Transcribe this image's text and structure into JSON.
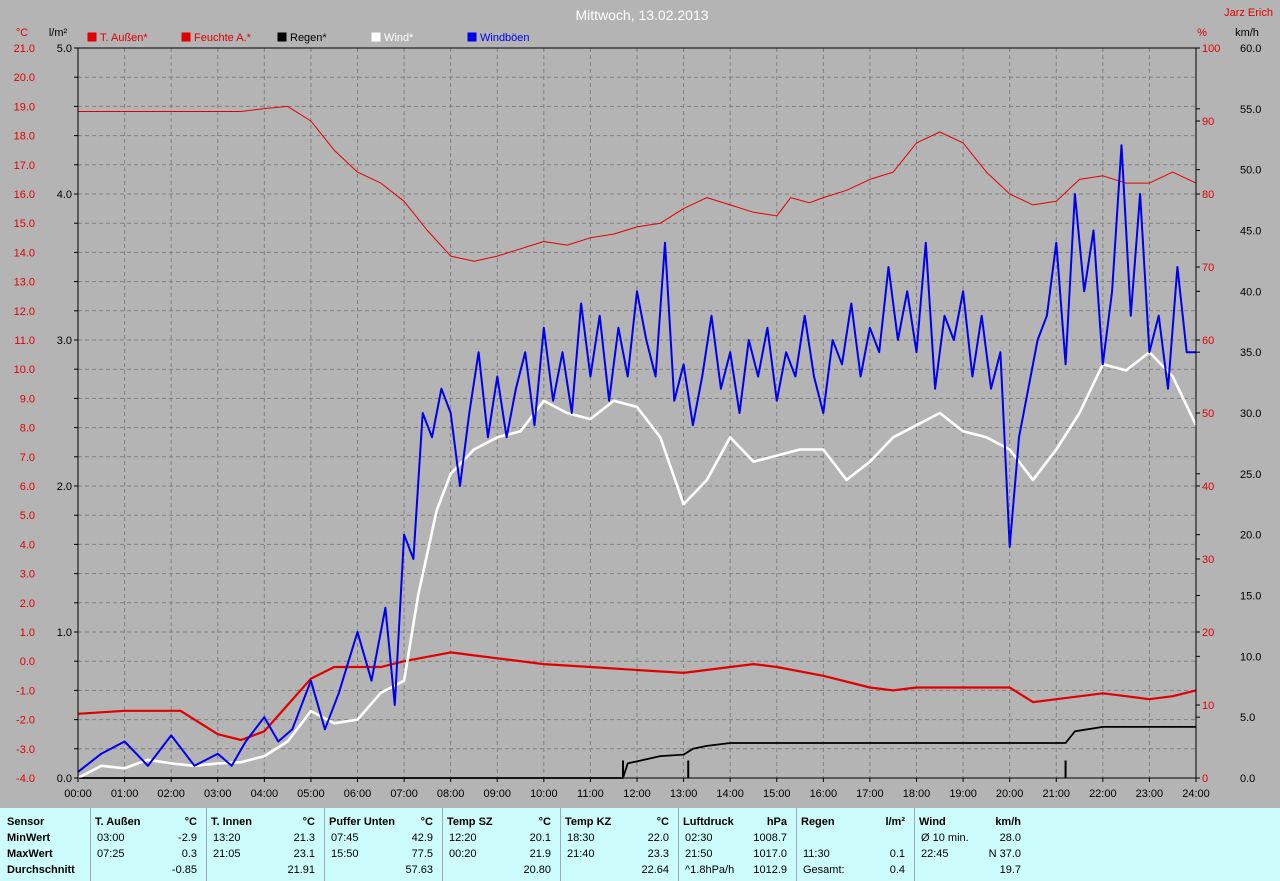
{
  "colors": {
    "background": "#b4b4b4",
    "temp_out": "#e00000",
    "humidity": "#e00000",
    "rain": "#000000",
    "wind": "#ffffff",
    "gusts": "#0000ee",
    "stats_background": "#ccfcfc"
  },
  "chart_data": {
    "type": "line",
    "title": "Mittwoch, 13.02.2013",
    "watermark": "Jarz Erich",
    "legend_position": "top-left",
    "grid": true,
    "x_range": [
      0,
      24
    ],
    "x_ticks": [
      "00:00",
      "01:00",
      "02:00",
      "03:00",
      "04:00",
      "05:00",
      "06:00",
      "07:00",
      "08:00",
      "09:00",
      "10:00",
      "11:00",
      "12:00",
      "13:00",
      "14:00",
      "15:00",
      "16:00",
      "17:00",
      "18:00",
      "19:00",
      "20:00",
      "21:00",
      "22:00",
      "23:00",
      "24:00"
    ],
    "axes": {
      "temp": {
        "unit": "°C",
        "range": [
          -4,
          21
        ],
        "ticks": [
          "21.0",
          "20.0",
          "19.0",
          "18.0",
          "17.0",
          "16.0",
          "15.0",
          "14.0",
          "13.0",
          "12.0",
          "11.0",
          "10.0",
          "9.0",
          "8.0",
          "7.0",
          "6.0",
          "5.0",
          "4.0",
          "3.0",
          "2.0",
          "1.0",
          "0.0",
          "-1.0",
          "-2.0",
          "-3.0",
          "-4.0"
        ]
      },
      "rain": {
        "unit": "l/m²",
        "range": [
          0,
          5
        ],
        "ticks": [
          "5.0",
          "4.0",
          "3.0",
          "2.0",
          "1.0",
          "0.0"
        ]
      },
      "humidity": {
        "unit": "%",
        "range": [
          0,
          100
        ],
        "ticks": [
          "100",
          "90",
          "80",
          "70",
          "60",
          "50",
          "40",
          "30",
          "20",
          "10",
          "0"
        ]
      },
      "wind": {
        "unit": "km/h",
        "range": [
          0,
          60
        ],
        "ticks": [
          "60.0",
          "55.0",
          "50.0",
          "45.0",
          "40.0",
          "35.0",
          "30.0",
          "25.0",
          "20.0",
          "15.0",
          "10.0",
          "5.0",
          "0.0"
        ]
      }
    },
    "series": [
      {
        "name": "T. Außen*",
        "axis": "temp",
        "color": "#e00000",
        "width": 2.2,
        "points": [
          [
            0,
            -1.8
          ],
          [
            1,
            -1.7
          ],
          [
            2.2,
            -1.7
          ],
          [
            3,
            -2.5
          ],
          [
            3.5,
            -2.7
          ],
          [
            4,
            -2.4
          ],
          [
            4.5,
            -1.5
          ],
          [
            5,
            -0.6
          ],
          [
            5.5,
            -0.2
          ],
          [
            6,
            -0.2
          ],
          [
            6.5,
            -0.2
          ],
          [
            7,
            0.0
          ],
          [
            8,
            0.3
          ],
          [
            8.5,
            0.2
          ],
          [
            9,
            0.1
          ],
          [
            10,
            -0.1
          ],
          [
            11,
            -0.2
          ],
          [
            12,
            -0.3
          ],
          [
            13,
            -0.4
          ],
          [
            14,
            -0.2
          ],
          [
            14.5,
            -0.1
          ],
          [
            15,
            -0.2
          ],
          [
            16,
            -0.5
          ],
          [
            17,
            -0.9
          ],
          [
            17.5,
            -1.0
          ],
          [
            18,
            -0.9
          ],
          [
            19,
            -0.9
          ],
          [
            20,
            -0.9
          ],
          [
            20.5,
            -1.4
          ],
          [
            21,
            -1.3
          ],
          [
            22,
            -1.1
          ],
          [
            22.5,
            -1.2
          ],
          [
            23,
            -1.3
          ],
          [
            23.5,
            -1.2
          ],
          [
            24,
            -1.0
          ]
        ]
      },
      {
        "name": "Feuchte A.*",
        "axis": "humidity",
        "color": "#e00000",
        "width": 1,
        "points": [
          [
            0,
            91.3
          ],
          [
            3.5,
            91.3
          ],
          [
            4,
            91.7
          ],
          [
            4.5,
            92
          ],
          [
            5,
            90
          ],
          [
            5.5,
            86
          ],
          [
            6,
            83
          ],
          [
            6.5,
            81.5
          ],
          [
            7,
            79
          ],
          [
            7.5,
            75
          ],
          [
            8,
            71.5
          ],
          [
            8.5,
            70.8
          ],
          [
            9,
            71.5
          ],
          [
            10,
            73.5
          ],
          [
            10.5,
            73
          ],
          [
            11,
            74
          ],
          [
            11.5,
            74.5
          ],
          [
            12,
            75.5
          ],
          [
            12.5,
            76
          ],
          [
            13,
            78
          ],
          [
            13.5,
            79.5
          ],
          [
            14,
            78.5
          ],
          [
            14.5,
            77.5
          ],
          [
            15,
            77
          ],
          [
            15.3,
            79.5
          ],
          [
            15.7,
            78.8
          ],
          [
            16,
            79.5
          ],
          [
            16.5,
            80.5
          ],
          [
            17,
            82
          ],
          [
            17.5,
            83
          ],
          [
            18,
            87
          ],
          [
            18.5,
            88.5
          ],
          [
            19,
            87
          ],
          [
            19.5,
            83
          ],
          [
            20,
            80
          ],
          [
            20.5,
            78.5
          ],
          [
            21,
            79
          ],
          [
            21.5,
            82
          ],
          [
            22,
            82.5
          ],
          [
            22.5,
            81.5
          ],
          [
            23,
            81.5
          ],
          [
            23.5,
            83
          ],
          [
            24,
            81.5
          ]
        ]
      },
      {
        "name": "Regen*",
        "axis": "rain",
        "color": "#000000",
        "width": 1.8,
        "points": [
          [
            0,
            0
          ],
          [
            11.7,
            0
          ],
          [
            11.8,
            0.1
          ],
          [
            12.5,
            0.15
          ],
          [
            13,
            0.16
          ],
          [
            13.2,
            0.2
          ],
          [
            13.5,
            0.22
          ],
          [
            14,
            0.24
          ],
          [
            20,
            0.24
          ],
          [
            21.2,
            0.24
          ],
          [
            21.4,
            0.32
          ],
          [
            22,
            0.35
          ],
          [
            24,
            0.35
          ]
        ],
        "spikes": [
          [
            11.7,
            0.12
          ],
          [
            13.1,
            0.12
          ],
          [
            21.2,
            0.12
          ]
        ]
      },
      {
        "name": "Wind*",
        "axis": "wind",
        "color": "#ffffff",
        "width": 2.6,
        "points": [
          [
            0,
            0
          ],
          [
            0.5,
            1
          ],
          [
            1,
            0.8
          ],
          [
            1.5,
            1.5
          ],
          [
            2,
            1.2
          ],
          [
            2.5,
            1
          ],
          [
            3,
            1.2
          ],
          [
            3.5,
            1.3
          ],
          [
            4,
            1.8
          ],
          [
            4.5,
            3
          ],
          [
            5,
            5.5
          ],
          [
            5.5,
            4.5
          ],
          [
            6,
            4.8
          ],
          [
            6.5,
            7
          ],
          [
            7,
            8
          ],
          [
            7.3,
            15
          ],
          [
            7.7,
            22
          ],
          [
            8,
            25
          ],
          [
            8.5,
            27
          ],
          [
            9,
            28
          ],
          [
            9.5,
            28.5
          ],
          [
            10,
            31
          ],
          [
            10.5,
            30
          ],
          [
            11,
            29.5
          ],
          [
            11.5,
            31
          ],
          [
            12,
            30.5
          ],
          [
            12.5,
            28
          ],
          [
            13,
            22.5
          ],
          [
            13.5,
            24.5
          ],
          [
            14,
            28
          ],
          [
            14.5,
            26
          ],
          [
            15,
            26.5
          ],
          [
            15.5,
            27
          ],
          [
            16,
            27
          ],
          [
            16.5,
            24.5
          ],
          [
            17,
            26
          ],
          [
            17.5,
            28
          ],
          [
            18,
            29
          ],
          [
            18.5,
            30
          ],
          [
            19,
            28.5
          ],
          [
            19.5,
            28
          ],
          [
            20,
            27
          ],
          [
            20.5,
            24.5
          ],
          [
            21,
            27
          ],
          [
            21.5,
            30
          ],
          [
            22,
            34
          ],
          [
            22.5,
            33.5
          ],
          [
            23,
            35
          ],
          [
            23.5,
            33
          ],
          [
            24,
            29
          ]
        ]
      },
      {
        "name": "Windböen",
        "axis": "wind",
        "color": "#0000ee",
        "width": 2,
        "points": [
          [
            0,
            0.5
          ],
          [
            0.5,
            2
          ],
          [
            1,
            3
          ],
          [
            1.5,
            1
          ],
          [
            2,
            3.5
          ],
          [
            2.5,
            1
          ],
          [
            3,
            2
          ],
          [
            3.3,
            1
          ],
          [
            3.6,
            3
          ],
          [
            4,
            5
          ],
          [
            4.3,
            3
          ],
          [
            4.6,
            4
          ],
          [
            5,
            8
          ],
          [
            5.3,
            4
          ],
          [
            5.6,
            7
          ],
          [
            6,
            12
          ],
          [
            6.3,
            8
          ],
          [
            6.6,
            14
          ],
          [
            6.8,
            6
          ],
          [
            7,
            20
          ],
          [
            7.2,
            18
          ],
          [
            7.4,
            30
          ],
          [
            7.6,
            28
          ],
          [
            7.8,
            32
          ],
          [
            8,
            30
          ],
          [
            8.2,
            24
          ],
          [
            8.4,
            30
          ],
          [
            8.6,
            35
          ],
          [
            8.8,
            28
          ],
          [
            9,
            33
          ],
          [
            9.2,
            28
          ],
          [
            9.4,
            32
          ],
          [
            9.6,
            35
          ],
          [
            9.8,
            29
          ],
          [
            10,
            37
          ],
          [
            10.2,
            31
          ],
          [
            10.4,
            35
          ],
          [
            10.6,
            30
          ],
          [
            10.8,
            39
          ],
          [
            11,
            33
          ],
          [
            11.2,
            38
          ],
          [
            11.4,
            31
          ],
          [
            11.6,
            37
          ],
          [
            11.8,
            33
          ],
          [
            12,
            40
          ],
          [
            12.2,
            36
          ],
          [
            12.4,
            33
          ],
          [
            12.6,
            44
          ],
          [
            12.8,
            31
          ],
          [
            13,
            34
          ],
          [
            13.2,
            29
          ],
          [
            13.4,
            33
          ],
          [
            13.6,
            38
          ],
          [
            13.8,
            32
          ],
          [
            14,
            35
          ],
          [
            14.2,
            30
          ],
          [
            14.4,
            36
          ],
          [
            14.6,
            33
          ],
          [
            14.8,
            37
          ],
          [
            15,
            31
          ],
          [
            15.2,
            35
          ],
          [
            15.4,
            33
          ],
          [
            15.6,
            38
          ],
          [
            15.8,
            33
          ],
          [
            16,
            30
          ],
          [
            16.2,
            36
          ],
          [
            16.4,
            34
          ],
          [
            16.6,
            39
          ],
          [
            16.8,
            33
          ],
          [
            17,
            37
          ],
          [
            17.2,
            35
          ],
          [
            17.4,
            42
          ],
          [
            17.6,
            36
          ],
          [
            17.8,
            40
          ],
          [
            18,
            35
          ],
          [
            18.2,
            44
          ],
          [
            18.4,
            32
          ],
          [
            18.6,
            38
          ],
          [
            18.8,
            36
          ],
          [
            19,
            40
          ],
          [
            19.2,
            33
          ],
          [
            19.4,
            38
          ],
          [
            19.6,
            32
          ],
          [
            19.8,
            35
          ],
          [
            20,
            19
          ],
          [
            20.2,
            28
          ],
          [
            20.4,
            32
          ],
          [
            20.6,
            36
          ],
          [
            20.8,
            38
          ],
          [
            21,
            44
          ],
          [
            21.2,
            34
          ],
          [
            21.4,
            48
          ],
          [
            21.6,
            40
          ],
          [
            21.8,
            45
          ],
          [
            22,
            34
          ],
          [
            22.2,
            40
          ],
          [
            22.4,
            52
          ],
          [
            22.6,
            38
          ],
          [
            22.8,
            48
          ],
          [
            23,
            35
          ],
          [
            23.2,
            38
          ],
          [
            23.4,
            32
          ],
          [
            23.6,
            42
          ],
          [
            23.8,
            35
          ],
          [
            24,
            35
          ]
        ]
      }
    ]
  },
  "stats": {
    "row_labels": [
      "Sensor",
      "MinWert",
      "MaxWert",
      "Durchschnitt"
    ],
    "columns": [
      {
        "title": "T. Außen",
        "unit": "°C",
        "min_time": "03:00",
        "min_val": "-2.9",
        "max_time": "07:25",
        "max_val": "0.3",
        "avg_time": "",
        "avg": "-0.85"
      },
      {
        "title": "T. Innen",
        "unit": "°C",
        "min_time": "13:20",
        "min_val": "21.3",
        "max_time": "21:05",
        "max_val": "23.1",
        "avg_time": "",
        "avg": "21.91"
      },
      {
        "title": "Puffer Unten",
        "unit": "°C",
        "min_time": "07:45",
        "min_val": "42.9",
        "max_time": "15:50",
        "max_val": "77.5",
        "avg_time": "",
        "avg": "57.63"
      },
      {
        "title": "Temp SZ",
        "unit": "°C",
        "min_time": "12:20",
        "min_val": "20.1",
        "max_time": "00:20",
        "max_val": "21.9",
        "avg_time": "",
        "avg": "20.80"
      },
      {
        "title": "Temp KZ",
        "unit": "°C",
        "min_time": "18:30",
        "min_val": "22.0",
        "max_time": "21:40",
        "max_val": "23.3",
        "avg_time": "",
        "avg": "22.64"
      },
      {
        "title": "Luftdruck",
        "unit": "hPa",
        "min_time": "02:30",
        "min_val": "1008.7",
        "max_time": "21:50",
        "max_val": "1017.0",
        "avg_time": "^1.8hPa/h",
        "avg": "1012.9"
      },
      {
        "title": "Regen",
        "unit": "l/m²",
        "min_time": "",
        "min_val": "",
        "max_time": "11:30",
        "max_val": "0.1",
        "avg_time": "Gesamt:",
        "avg": "0.4"
      },
      {
        "title": "Wind",
        "unit": "km/h",
        "min_time": "Ø 10 min.",
        "min_val": "28.0",
        "max_time": "22:45",
        "max_val": "N 37.0",
        "avg_time": "",
        "avg": "19.7"
      }
    ]
  }
}
